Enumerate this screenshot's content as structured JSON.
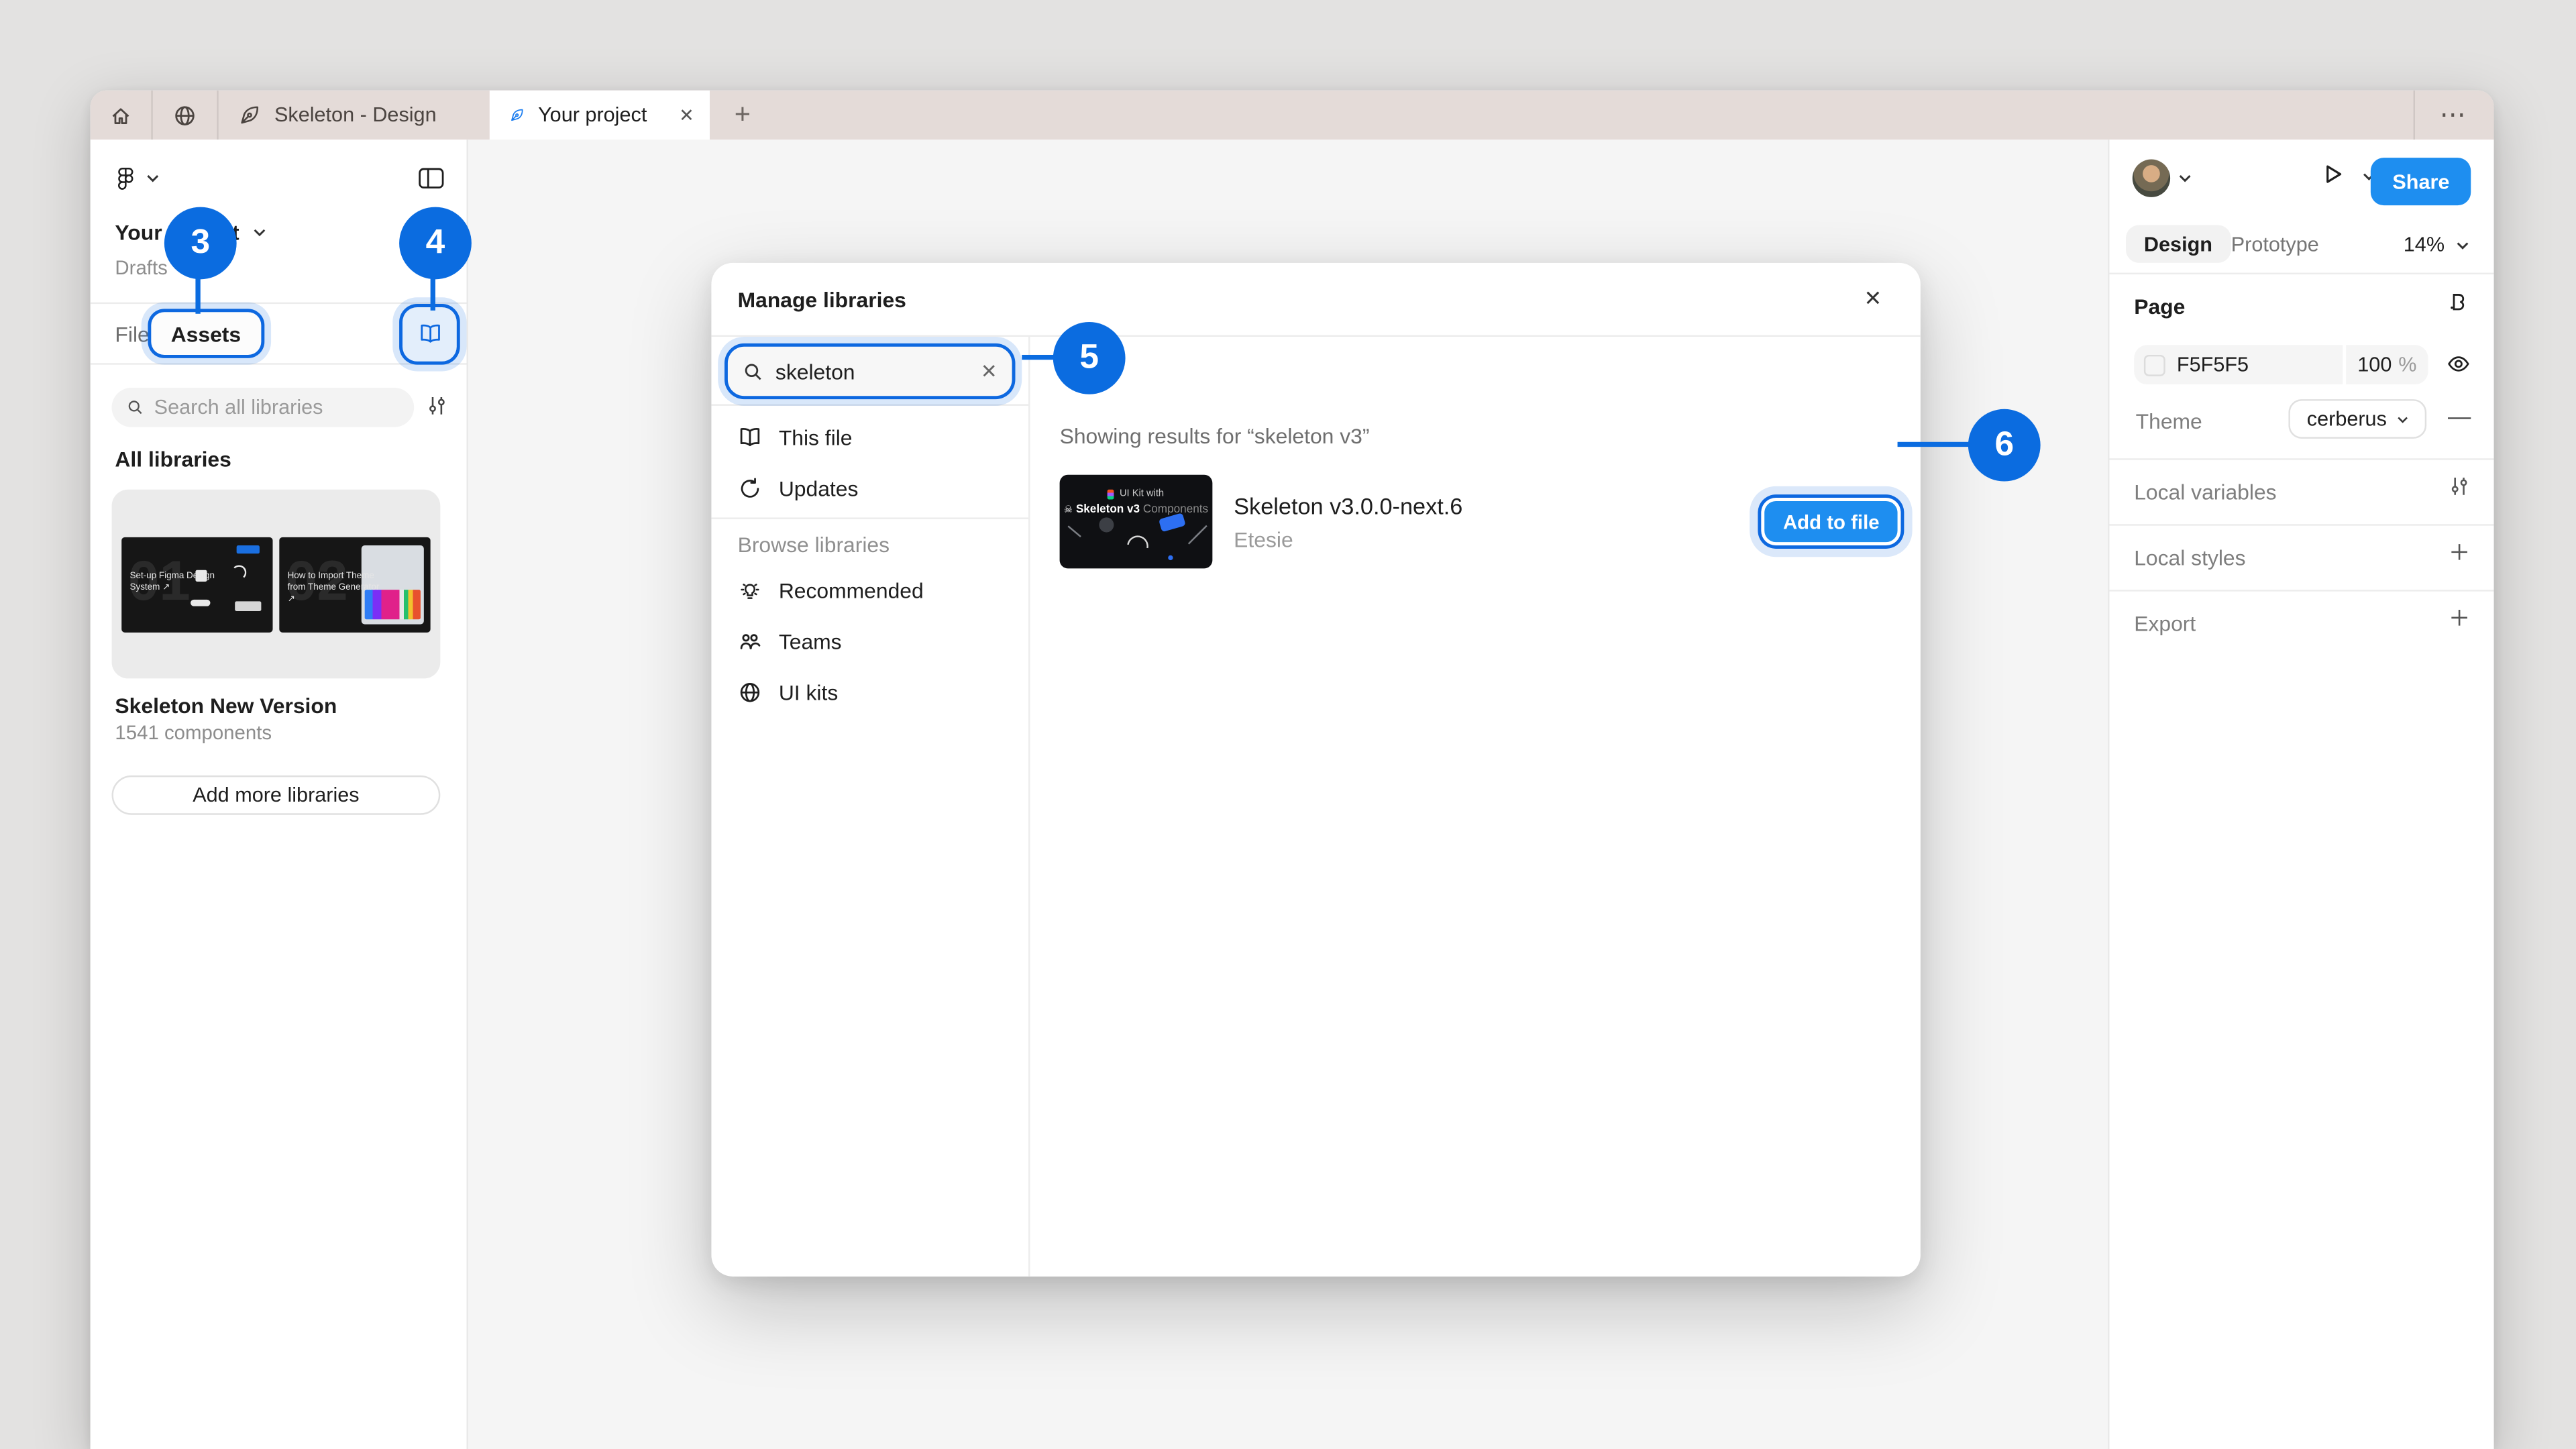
{
  "colors": {
    "accent_blue": "#0B6CE0",
    "primary_button_blue": "#1E8EF0",
    "tabbar_bg": "#E4DBD8",
    "canvas_bg": "#F5F5F5",
    "desktop_bg": "#E3E2E1"
  },
  "tabbar": {
    "tabs": [
      {
        "label": "Skeleton - Design",
        "active": false
      },
      {
        "label": "Your project",
        "active": true
      }
    ],
    "plus_glyph": "+",
    "more_glyph": "⋯",
    "close_glyph": "✕"
  },
  "sidebar": {
    "project_title": "Your project",
    "project_subtitle": "Drafts",
    "tab_file": "File",
    "tab_assets": "Assets",
    "search_placeholder": "Search all libraries",
    "section_all_libraries": "All libraries",
    "library": {
      "thumb1_caption": "Set-up Figma Design System ↗",
      "thumb1_ghost": "01",
      "thumb2_caption": "How to Import Theme from Theme Generator ↗",
      "thumb2_ghost": "02",
      "name": "Skeleton New Version",
      "count": "1541 components"
    },
    "add_button": "Add more libraries"
  },
  "modal": {
    "title": "Manage libraries",
    "close_glyph": "✕",
    "search_value": "skeleton",
    "clear_glyph": "✕",
    "nav": {
      "this_file": "This file",
      "updates": "Updates",
      "browse_section": "Browse libraries",
      "recommended": "Recommended",
      "teams": "Teams",
      "ui_kits": "UI kits"
    },
    "results_note": "Showing results for “skeleton v3”",
    "result": {
      "title": "Skeleton v3.0.0-next.6",
      "author": "Etesie",
      "action": "Add to file",
      "thumb_line1": "UI Kit with",
      "thumb_skull": "☠",
      "thumb_line2_strong": "Skeleton v3",
      "thumb_line2_rest": " Components"
    }
  },
  "badges": {
    "step3": "3",
    "step4": "4",
    "step5": "5",
    "step6": "6"
  },
  "right_panel": {
    "share": "Share",
    "tab_design": "Design",
    "tab_prototype": "Prototype",
    "zoom": "14%",
    "page_label": "Page",
    "page_color": "F5F5F5",
    "page_opacity": "100",
    "percent": "%",
    "theme_label": "Theme",
    "theme_value": "cerberus",
    "minus_glyph": "—",
    "local_variables": "Local variables",
    "local_styles": "Local styles",
    "export": "Export"
  }
}
